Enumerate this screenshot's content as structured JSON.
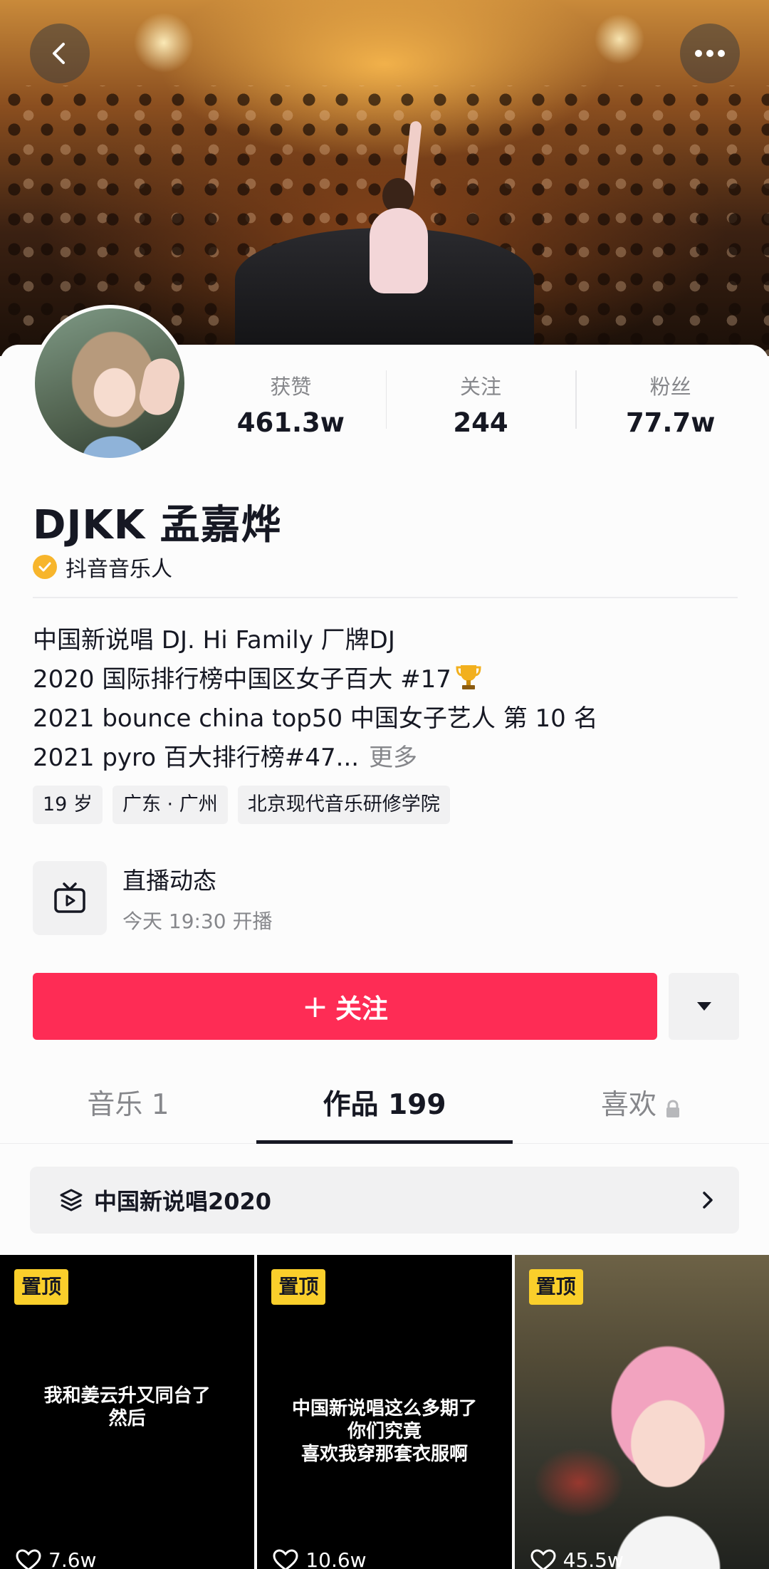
{
  "header": {
    "back_icon": "chevron-left-icon",
    "more_icon": "ellipsis-icon"
  },
  "profile": {
    "name": "DJKK 孟嘉烨",
    "verified_label": "抖音音乐人",
    "stats": [
      {
        "label": "获赞",
        "value": "461.3w"
      },
      {
        "label": "关注",
        "value": "244"
      },
      {
        "label": "粉丝",
        "value": "77.7w"
      }
    ],
    "bio_lines": [
      "中国新说唱 DJ.     Hi Family 厂牌DJ",
      "2020 国际排行榜中国区女子百大 #17",
      "2021 bounce china top50 中国女子艺人 第 10 名",
      "2021 pyro 百大排行榜#47..."
    ],
    "bio_more": "更多",
    "tags": [
      "19 岁",
      "广东 · 广州",
      "北京现代音乐研修学院"
    ]
  },
  "live": {
    "title": "直播动态",
    "subtitle": "今天 19:30 开播"
  },
  "actions": {
    "follow_plus": "+",
    "follow_label": "关注"
  },
  "tabs": [
    {
      "label": "音乐 1",
      "active": false
    },
    {
      "label": "作品 199",
      "active": true
    },
    {
      "label": "喜欢",
      "active": false,
      "locked": true
    }
  ],
  "collection": {
    "title": "中国新说唱2020"
  },
  "videos": [
    {
      "pinned": "置顶",
      "caption": [
        "我和姜云升又同台了",
        "然后"
      ],
      "likes": "7.6w"
    },
    {
      "pinned": "置顶",
      "caption": [
        "中国新说唱这么多期了",
        "你们究竟",
        "喜欢我穿那套衣服啊"
      ],
      "likes": "10.6w"
    },
    {
      "pinned": "置顶",
      "caption": [],
      "likes": "45.5w"
    }
  ],
  "colors": {
    "primary": "#fe2c55",
    "text": "#161823",
    "secondary_text": "#86878b",
    "pin_badge": "#facf2b",
    "verified_badge": "#f7b52c"
  }
}
